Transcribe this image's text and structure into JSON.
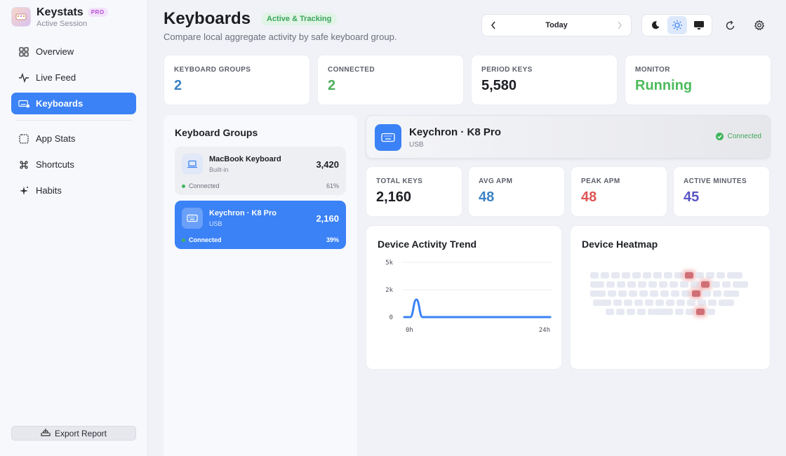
{
  "brand": {
    "name": "Keystats",
    "badge": "PRO",
    "subtitle": "Active Session"
  },
  "sidebar": {
    "items": [
      {
        "label": "Overview",
        "icon": "grid-icon",
        "active": false
      },
      {
        "label": "Live Feed",
        "icon": "pulse-icon",
        "active": false
      },
      {
        "label": "Keyboards",
        "icon": "keyboard-icon",
        "active": true
      },
      {
        "label": "App Stats",
        "icon": "app-square-icon",
        "active": false
      },
      {
        "label": "Shortcuts",
        "icon": "command-icon",
        "active": false
      },
      {
        "label": "Habits",
        "icon": "sparkle-icon",
        "active": false
      }
    ],
    "export_label": "Export Report"
  },
  "header": {
    "title": "Keyboards",
    "status": "Active & Tracking",
    "subtitle": "Compare local aggregate activity by safe keyboard group.",
    "date_label": "Today"
  },
  "stats": [
    {
      "label": "KEYBOARD GROUPS",
      "value": "2",
      "color": "#3b82c4"
    },
    {
      "label": "CONNECTED",
      "value": "2",
      "color": "#4cae5c"
    },
    {
      "label": "PERIOD KEYS",
      "value": "5,580",
      "color": "#1d1f24"
    },
    {
      "label": "MONITOR",
      "value": "Running",
      "color": "#4cbb5c"
    }
  ],
  "groups": {
    "title": "Keyboard Groups",
    "items": [
      {
        "name": "MacBook Keyboard",
        "type": "Built-in",
        "count": "3,420",
        "status": "Connected",
        "pct": "61%",
        "active": false
      },
      {
        "name": "Keychron · K8 Pro",
        "type": "USB",
        "count": "2,160",
        "status": "Connected",
        "pct": "39%",
        "active": true
      }
    ]
  },
  "device": {
    "name": "Keychron · K8 Pro",
    "type": "USB",
    "status": "Connected"
  },
  "metrics": [
    {
      "label": "TOTAL KEYS",
      "value": "2,160",
      "color": "#1d1f24"
    },
    {
      "label": "AVG APM",
      "value": "48",
      "color": "#3b82c4"
    },
    {
      "label": "PEAK APM",
      "value": "48",
      "color": "#e05454"
    },
    {
      "label": "ACTIVE MINUTES",
      "value": "45",
      "color": "#5a55c4"
    }
  ],
  "trend": {
    "title": "Device Activity Trend",
    "chart_data": {
      "type": "line",
      "x_ticks": [
        "0h",
        "24h"
      ],
      "y_ticks": [
        "5k",
        "2k",
        "0"
      ],
      "x": [
        0,
        1,
        2,
        3,
        4,
        24
      ],
      "values": [
        0,
        0,
        1600,
        0,
        0,
        0
      ],
      "ylim": [
        0,
        5000
      ],
      "color": "#3b82f6"
    }
  },
  "heatmap": {
    "title": "Device Heatmap"
  }
}
